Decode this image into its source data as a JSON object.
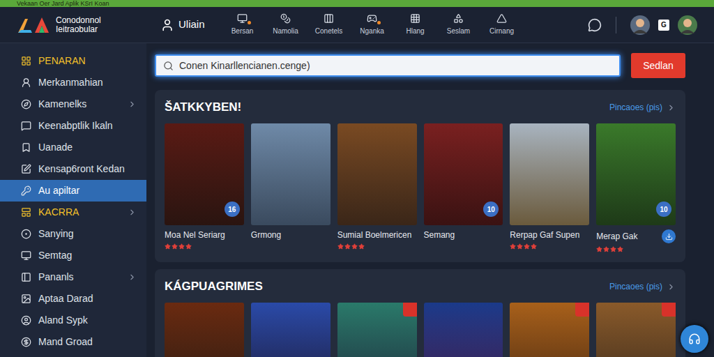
{
  "window": {
    "title": "Vekaan Oer Jard Aplik KSrI Koan"
  },
  "logo": {
    "lines": [
      "Conodonnol",
      "Ieitraobular"
    ]
  },
  "nav": [
    {
      "label": "Uliain",
      "selected": true,
      "dot": false
    },
    {
      "label": "Bersan",
      "selected": false,
      "dot": true
    },
    {
      "label": "Namolia",
      "selected": false,
      "dot": false
    },
    {
      "label": "Conetels",
      "selected": false,
      "dot": false
    },
    {
      "label": "Nganka",
      "selected": false,
      "dot": true
    },
    {
      "label": "Hlang",
      "selected": false,
      "dot": false
    },
    {
      "label": "Seslam",
      "selected": false,
      "dot": false
    },
    {
      "label": "Cirnang",
      "selected": false,
      "dot": false
    }
  ],
  "header_badge": "G",
  "sidebar": {
    "items": [
      {
        "label": "PENARAN",
        "kind": "header",
        "selected": false,
        "expandable": false
      },
      {
        "label": "Merkanmahian",
        "kind": "item",
        "selected": false,
        "expandable": false
      },
      {
        "label": "Kamenelks",
        "kind": "item",
        "selected": false,
        "expandable": true
      },
      {
        "label": "Keenabptlik Ikaln",
        "kind": "item",
        "selected": false,
        "expandable": false
      },
      {
        "label": "Uanade",
        "kind": "item",
        "selected": false,
        "expandable": false
      },
      {
        "label": "Kensap6ront Kedan",
        "kind": "item",
        "selected": false,
        "expandable": false
      },
      {
        "label": "Au apiltar",
        "kind": "item",
        "selected": true,
        "expandable": false
      },
      {
        "label": "KACRRA",
        "kind": "header",
        "selected": false,
        "expandable": true
      },
      {
        "label": "Sanying",
        "kind": "item",
        "selected": false,
        "expandable": false
      },
      {
        "label": "Semtag",
        "kind": "item",
        "selected": false,
        "expandable": false
      },
      {
        "label": "Pananls",
        "kind": "item",
        "selected": false,
        "expandable": true
      },
      {
        "label": "Aptaa Darad",
        "kind": "item",
        "selected": false,
        "expandable": false
      },
      {
        "label": "Aland Sypk",
        "kind": "item",
        "selected": false,
        "expandable": false
      },
      {
        "label": "Mand Groad",
        "kind": "item",
        "selected": false,
        "expandable": false
      }
    ]
  },
  "search": {
    "placeholder": "Conen Kinarllencianen.cenge)",
    "button": "Sedlan"
  },
  "sections": [
    {
      "title": "ŠATKKYBEN!",
      "link": "Pincaoes (pis)",
      "cards": [
        {
          "title": "Moa Nel Seriarg",
          "stars": 4,
          "badge": "16",
          "download": false,
          "ribbon": false
        },
        {
          "title": "Grmong",
          "stars": 0,
          "badge": "",
          "download": false,
          "ribbon": false
        },
        {
          "title": "Sumial Boelmericen",
          "stars": 4,
          "badge": "",
          "download": false,
          "ribbon": false
        },
        {
          "title": "Semang",
          "stars": 0,
          "badge": "10",
          "download": false,
          "ribbon": false
        },
        {
          "title": "Rerpap Gaf Supen",
          "stars": 4,
          "badge": "",
          "download": false,
          "ribbon": false
        },
        {
          "title": "Merap Gak",
          "stars": 4,
          "badge": "10",
          "download": true,
          "ribbon": false
        }
      ]
    },
    {
      "title": "KÁGPUAGRIMES",
      "link": "Pincaoes (pis)",
      "cards": [
        {
          "title": "",
          "stars": 0,
          "badge": "",
          "download": false,
          "ribbon": false
        },
        {
          "title": "",
          "stars": 0,
          "badge": "",
          "download": false,
          "ribbon": false
        },
        {
          "title": "",
          "stars": 0,
          "badge": "",
          "download": false,
          "ribbon": true
        },
        {
          "title": "",
          "stars": 0,
          "badge": "",
          "download": false,
          "ribbon": false
        },
        {
          "title": "",
          "stars": 0,
          "badge": "",
          "download": false,
          "ribbon": true
        },
        {
          "title": "",
          "stars": 0,
          "badge": "",
          "download": false,
          "ribbon": true
        }
      ]
    }
  ]
}
